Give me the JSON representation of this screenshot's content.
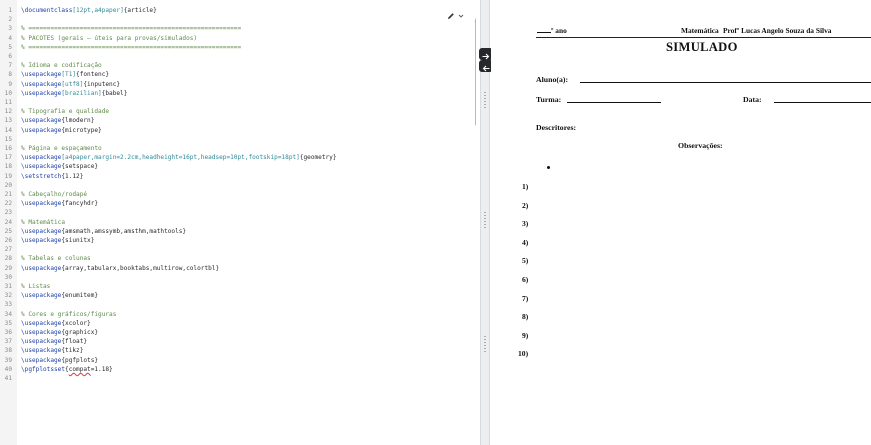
{
  "editor": {
    "lines": [
      {
        "n": "1",
        "tokens": [
          {
            "t": "\\documentclass",
            "k": "cmd"
          },
          {
            "t": "[12pt,a4paper]",
            "k": "arg"
          },
          {
            "t": "{article}",
            "k": "plain"
          }
        ]
      },
      {
        "n": "2",
        "tokens": []
      },
      {
        "n": "3",
        "tokens": [
          {
            "t": "% ==========================================================",
            "k": "comment"
          }
        ]
      },
      {
        "n": "4",
        "tokens": [
          {
            "t": "% PACOTES (gerais – úteis para provas/simulados)",
            "k": "comment"
          }
        ]
      },
      {
        "n": "5",
        "tokens": [
          {
            "t": "% ==========================================================",
            "k": "comment"
          }
        ]
      },
      {
        "n": "6",
        "tokens": []
      },
      {
        "n": "7",
        "tokens": [
          {
            "t": "% Idioma e codificação",
            "k": "comment"
          }
        ]
      },
      {
        "n": "8",
        "tokens": [
          {
            "t": "\\usepackage",
            "k": "cmd"
          },
          {
            "t": "[T1]",
            "k": "arg"
          },
          {
            "t": "{fontenc}",
            "k": "plain"
          }
        ]
      },
      {
        "n": "9",
        "tokens": [
          {
            "t": "\\usepackage",
            "k": "cmd"
          },
          {
            "t": "[utf8]",
            "k": "arg"
          },
          {
            "t": "{inputenc}",
            "k": "plain"
          }
        ]
      },
      {
        "n": "10",
        "tokens": [
          {
            "t": "\\usepackage",
            "k": "cmd"
          },
          {
            "t": "[brazilian]",
            "k": "arg"
          },
          {
            "t": "{babel}",
            "k": "plain"
          }
        ]
      },
      {
        "n": "11",
        "tokens": []
      },
      {
        "n": "12",
        "tokens": [
          {
            "t": "% Tipografia e qualidade",
            "k": "comment"
          }
        ]
      },
      {
        "n": "13",
        "tokens": [
          {
            "t": "\\usepackage",
            "k": "cmd"
          },
          {
            "t": "{lmodern}",
            "k": "plain"
          }
        ]
      },
      {
        "n": "14",
        "tokens": [
          {
            "t": "\\usepackage",
            "k": "cmd"
          },
          {
            "t": "{microtype}",
            "k": "plain"
          }
        ]
      },
      {
        "n": "15",
        "tokens": []
      },
      {
        "n": "16",
        "tokens": [
          {
            "t": "% Página e espaçamento",
            "k": "comment"
          }
        ]
      },
      {
        "n": "17",
        "tokens": [
          {
            "t": "\\usepackage",
            "k": "cmd"
          },
          {
            "t": "[a4paper,margin=2.2cm,headheight=16pt,headsep=10pt,footskip=18pt]",
            "k": "arg"
          },
          {
            "t": "{geometry}",
            "k": "plain"
          }
        ]
      },
      {
        "n": "18",
        "tokens": [
          {
            "t": "\\usepackage",
            "k": "cmd"
          },
          {
            "t": "{setspace}",
            "k": "plain"
          }
        ]
      },
      {
        "n": "19",
        "tokens": [
          {
            "t": "\\setstretch",
            "k": "cmd"
          },
          {
            "t": "{1.12}",
            "k": "plain"
          }
        ]
      },
      {
        "n": "20",
        "tokens": []
      },
      {
        "n": "21",
        "tokens": [
          {
            "t": "% Cabeçalho/rodapé",
            "k": "comment"
          }
        ]
      },
      {
        "n": "22",
        "tokens": [
          {
            "t": "\\usepackage",
            "k": "cmd"
          },
          {
            "t": "{fancyhdr}",
            "k": "plain"
          }
        ]
      },
      {
        "n": "23",
        "tokens": []
      },
      {
        "n": "24",
        "tokens": [
          {
            "t": "% Matemática",
            "k": "comment"
          }
        ]
      },
      {
        "n": "25",
        "tokens": [
          {
            "t": "\\usepackage",
            "k": "cmd"
          },
          {
            "t": "{amsmath,amssymb,amsthm,mathtools}",
            "k": "plain"
          }
        ]
      },
      {
        "n": "26",
        "tokens": [
          {
            "t": "\\usepackage",
            "k": "cmd"
          },
          {
            "t": "{siunitx}",
            "k": "plain"
          }
        ]
      },
      {
        "n": "27",
        "tokens": []
      },
      {
        "n": "28",
        "tokens": [
          {
            "t": "% Tabelas e colunas",
            "k": "comment"
          }
        ]
      },
      {
        "n": "29",
        "tokens": [
          {
            "t": "\\usepackage",
            "k": "cmd"
          },
          {
            "t": "{array,tabularx,booktabs,multirow,colortbl}",
            "k": "plain"
          }
        ]
      },
      {
        "n": "30",
        "tokens": []
      },
      {
        "n": "31",
        "tokens": [
          {
            "t": "% Listas",
            "k": "comment"
          }
        ]
      },
      {
        "n": "32",
        "tokens": [
          {
            "t": "\\usepackage",
            "k": "cmd"
          },
          {
            "t": "{enumitem}",
            "k": "plain"
          }
        ]
      },
      {
        "n": "33",
        "tokens": []
      },
      {
        "n": "34",
        "tokens": [
          {
            "t": "% Cores e gráficos/figuras",
            "k": "comment"
          }
        ]
      },
      {
        "n": "35",
        "tokens": [
          {
            "t": "\\usepackage",
            "k": "cmd"
          },
          {
            "t": "{xcolor}",
            "k": "plain"
          }
        ]
      },
      {
        "n": "36",
        "tokens": [
          {
            "t": "\\usepackage",
            "k": "cmd"
          },
          {
            "t": "{graphicx}",
            "k": "plain"
          }
        ]
      },
      {
        "n": "37",
        "tokens": [
          {
            "t": "\\usepackage",
            "k": "cmd"
          },
          {
            "t": "{float}",
            "k": "plain"
          }
        ]
      },
      {
        "n": "38",
        "tokens": [
          {
            "t": "\\usepackage",
            "k": "cmd"
          },
          {
            "t": "{tikz}",
            "k": "plain"
          }
        ]
      },
      {
        "n": "39",
        "tokens": [
          {
            "t": "\\usepackage",
            "k": "cmd"
          },
          {
            "t": "{pgfplots}",
            "k": "plain"
          }
        ]
      },
      {
        "n": "40",
        "tokens": [
          {
            "t": "\\pgfplotsset",
            "k": "cmd"
          },
          {
            "t": "{",
            "k": "plain"
          },
          {
            "t": "compat",
            "k": "spell"
          },
          {
            "t": "=1.18}",
            "k": "plain"
          }
        ]
      },
      {
        "n": "41",
        "tokens": []
      }
    ],
    "icons": {
      "edit": "pencil-icon",
      "menu": "chevron-down-icon",
      "scroll_up": "arrow-up-icon"
    }
  },
  "divider": {
    "icons": [
      "arrow-right-icon",
      "arrow-left-icon"
    ]
  },
  "preview": {
    "header": {
      "grade_suffix": "º ano",
      "subject": "Matemática",
      "teacher": "Profº Lucas Angelo Souza da Silva"
    },
    "title": "SIMULADO",
    "fields": {
      "student": "Aluno(a):",
      "class": "Turma:",
      "date": "Data:"
    },
    "descriptors_label": "Descritores:",
    "observations_label": "Observações:",
    "questions": [
      "1)",
      "2)",
      "3)",
      "4)",
      "5)",
      "6)",
      "7)",
      "8)",
      "9)",
      "10)"
    ]
  },
  "colors": {
    "latex_command": "#1d3fa6",
    "latex_option": "#2f8a96",
    "latex_comment": "#5e8a4a",
    "line_number": "#8a8a8a",
    "divider_button": "#26282b"
  }
}
